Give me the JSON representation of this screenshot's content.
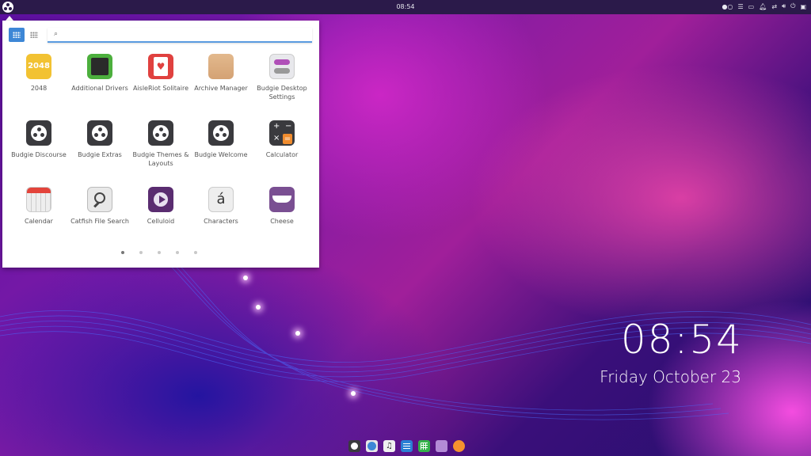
{
  "panel": {
    "time": "08:54",
    "tray_icons": [
      "toggle-indicator-icon",
      "notifications-list-icon",
      "folder-icon",
      "bell-icon",
      "network-icon",
      "volume-icon",
      "power-icon",
      "raven-icon"
    ]
  },
  "menu": {
    "view_grid_icon": "grid-view-icon",
    "view_list_icon": "compact-view-icon",
    "search_value": "",
    "apps": [
      {
        "label": "2048",
        "icon": "2048-icon"
      },
      {
        "label": "Additional Drivers",
        "icon": "chip-icon"
      },
      {
        "label": "AisleRiot Solitaire",
        "icon": "cards-icon"
      },
      {
        "label": "Archive Manager",
        "icon": "archive-icon"
      },
      {
        "label": "Budgie Desktop Settings",
        "icon": "settings-toggle-icon"
      },
      {
        "label": "Budgie Discourse",
        "icon": "budgie-icon"
      },
      {
        "label": "Budgie Extras",
        "icon": "budgie-icon"
      },
      {
        "label": "Budgie Themes & Layouts",
        "icon": "budgie-icon"
      },
      {
        "label": "Budgie Welcome",
        "icon": "budgie-icon"
      },
      {
        "label": "Calculator",
        "icon": "calculator-icon"
      },
      {
        "label": "Calendar",
        "icon": "calendar-icon"
      },
      {
        "label": "Catfish File Search",
        "icon": "magnifier-icon"
      },
      {
        "label": "Celluloid",
        "icon": "play-icon"
      },
      {
        "label": "Characters",
        "icon": "characters-icon"
      },
      {
        "label": "Cheese",
        "icon": "cheese-icon"
      }
    ],
    "char_glyph": "á",
    "calc_glyphs": [
      "+",
      "−",
      "×",
      "="
    ],
    "pages": 5,
    "current_page": 1
  },
  "desktop": {
    "time": "08:54",
    "date": "Friday October 23"
  },
  "dock": [
    "budgie-icon",
    "browser-icon",
    "music-icon",
    "text-editor-icon",
    "spreadsheet-icon",
    "files-icon",
    "firefox-icon"
  ]
}
